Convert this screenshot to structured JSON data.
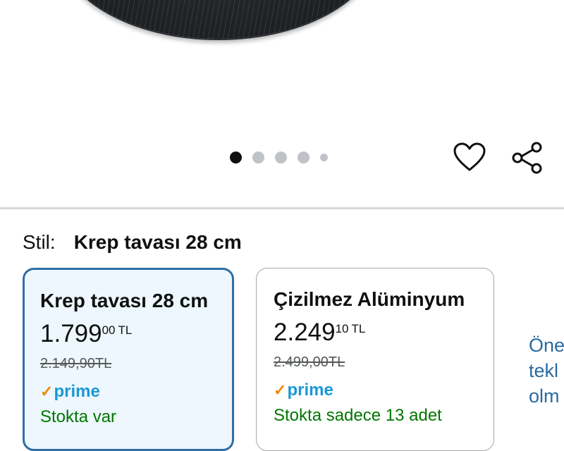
{
  "gallery": {
    "dot_count": 5,
    "active_index": 0,
    "favorite_icon": "heart-outline-icon",
    "share_icon": "share-icon"
  },
  "style": {
    "key": "Stil:",
    "value": "Krep tavası 28 cm"
  },
  "options": [
    {
      "title": "Krep tavası 28 cm",
      "price_whole": "1.799",
      "price_fraction": "00",
      "currency": "TL",
      "old_price": "2.149,90TL",
      "prime": "prime",
      "stock": "Stokta var",
      "selected": true
    },
    {
      "title": "Çizilmez Alüminyum",
      "price_whole": "2.249",
      "price_fraction": "10",
      "currency": "TL",
      "old_price": "2.499,00TL",
      "prime": "prime",
      "stock": "Stokta sadece 13 adet",
      "selected": false
    }
  ],
  "side_info": [
    "Öne",
    "tekl",
    "olm"
  ],
  "colors": {
    "selected_border": "#2f6ea5",
    "selected_bg": "#edf7fd",
    "prime_blue": "#1a98d5",
    "prime_check": "#f08804",
    "stock_green": "#007600",
    "link_blue": "#2a6aa0"
  }
}
